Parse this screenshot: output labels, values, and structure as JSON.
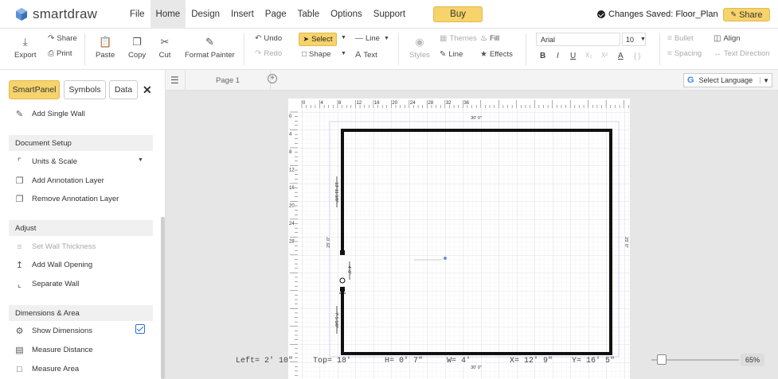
{
  "app": {
    "name": "smartdraw"
  },
  "menu": [
    "File",
    "Home",
    "Design",
    "Insert",
    "Page",
    "Table",
    "Options",
    "Support"
  ],
  "buy_label": "Buy",
  "status_saved": "Changes Saved: Floor_Plan",
  "share_label": "Share",
  "ribbon": {
    "export": "Export",
    "share": "Share",
    "print": "Print",
    "paste": "Paste",
    "copy": "Copy",
    "cut": "Cut",
    "format_painter": "Format Painter",
    "undo": "Undo",
    "redo": "Redo",
    "select": "Select",
    "shape": "Shape",
    "line": "Line",
    "text": "Text",
    "styles": "Styles",
    "themes": "Themes",
    "fill": "Fill",
    "line2": "Line",
    "effects": "Effects",
    "font": "Arial",
    "font_size": "10",
    "bullet": "Bullet",
    "align": "Align",
    "spacing": "Spacing",
    "text_direction": "Text Direction"
  },
  "panel": {
    "tabs": [
      "SmartPanel",
      "Symbols",
      "Data"
    ],
    "add_single_wall": "Add Single Wall",
    "sections": {
      "document_setup": "Document Setup",
      "adjust": "Adjust",
      "dimensions": "Dimensions & Area"
    },
    "items": {
      "units_scale": "Units & Scale",
      "add_annotation": "Add Annotation Layer",
      "remove_annotation": "Remove Annotation Layer",
      "set_wall_thickness": "Set Wall Thickness",
      "add_wall_opening": "Add Wall Opening",
      "separate_wall": "Separate Wall",
      "show_dimensions": "Show Dimensions",
      "measure_distance": "Measure Distance",
      "measure_area": "Measure Area"
    },
    "show_dimensions_checked": true
  },
  "pages": {
    "tab": "Page 1"
  },
  "language": "Select Language",
  "ruler": {
    "top": [
      "0",
      "4",
      "8",
      "12",
      "16",
      "20",
      "24",
      "28",
      "32",
      "36"
    ],
    "left": [
      "0",
      "4",
      "8",
      "12",
      "16",
      "20",
      "24",
      "28"
    ]
  },
  "dimensions": {
    "top": "30' 0\"",
    "bottom": "30' 0\"",
    "left": "25' 0\"",
    "right": "25' 0\"",
    "upper_segment": "13' 11 3/8\"",
    "opening": "4' 0\"",
    "lower_segment": "7' 5 5/8\""
  },
  "status": {
    "left": "Left= 2' 10\"",
    "top": "Top= 18'",
    "h": "H= 0' 7\"",
    "w": "W= 4'",
    "x": "X= 12' 9\"",
    "y": "Y= 16' 5\""
  },
  "zoom": "65%",
  "colors": {
    "accent": "#f6d36b",
    "wall": "#111111",
    "check": "#2a6fd1"
  }
}
